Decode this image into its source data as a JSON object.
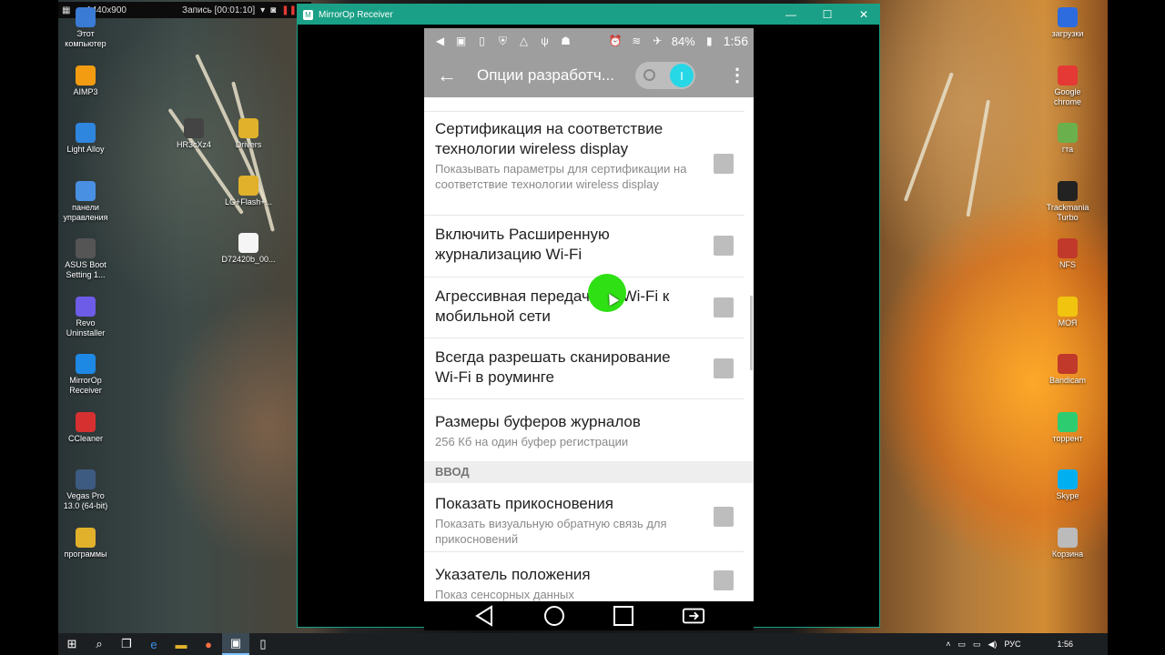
{
  "recorder": {
    "resolution": "1440x900",
    "recording_label": "Запись [00:01:10]"
  },
  "desktop_left_icons": [
    {
      "label": "Этот компьютер",
      "icon": "computer-icon",
      "color": "#3a7bd5"
    },
    {
      "label": "AIMP3",
      "icon": "aimp-icon",
      "color": "#f39c12"
    },
    {
      "label": "Light Alloy",
      "icon": "light-alloy-icon",
      "color": "#2e86de"
    },
    {
      "label": "панели управления",
      "icon": "control-panel-icon",
      "color": "#4a90e2"
    },
    {
      "label": "ASUS Boot Setting 1...",
      "icon": "asus-icon",
      "color": "#555"
    },
    {
      "label": "Revo Uninstaller",
      "icon": "revo-icon",
      "color": "#6c5ce7"
    },
    {
      "label": "MirrorOp Receiver",
      "icon": "mirrorop-icon",
      "color": "#1e88e5"
    },
    {
      "label": "CCleaner",
      "icon": "ccleaner-icon",
      "color": "#d63031"
    },
    {
      "label": "Vegas Pro 13.0 (64-bit)",
      "icon": "vegas-icon",
      "color": "#3d5a80"
    },
    {
      "label": "программы",
      "icon": "folder-icon",
      "color": "#e1b12c"
    }
  ],
  "desktop_mid_icons": [
    {
      "label": "HR3cXz4",
      "icon": "file-icon",
      "color": "#444"
    },
    {
      "label": "Drivers",
      "icon": "folder-icon",
      "color": "#e1b12c"
    },
    {
      "label": "LG+Flash+...",
      "icon": "folder-icon",
      "color": "#e1b12c"
    },
    {
      "label": "D72420b_00...",
      "icon": "document-icon",
      "color": "#f5f5f5"
    }
  ],
  "desktop_right_icons": [
    {
      "label": "загрузки",
      "icon": "downloads-icon",
      "color": "#2d6cdf"
    },
    {
      "label": "Google chrome",
      "icon": "chrome-icon",
      "color": "#e53935"
    },
    {
      "label": "гта",
      "icon": "gta-icon",
      "color": "#6ab04c"
    },
    {
      "label": "Trackmania Turbo",
      "icon": "trackmania-icon",
      "color": "#222"
    },
    {
      "label": "NFS",
      "icon": "nfs-icon",
      "color": "#c0392b"
    },
    {
      "label": "МОЯ",
      "icon": "warning-icon",
      "color": "#f1c40f"
    },
    {
      "label": "Bandicam",
      "icon": "bandicam-icon",
      "color": "#c0392b"
    },
    {
      "label": "торрент",
      "icon": "utorrent-icon",
      "color": "#2ecc71"
    },
    {
      "label": "Skype",
      "icon": "skype-icon",
      "color": "#00aff0"
    },
    {
      "label": "Корзина",
      "icon": "recycle-bin-icon",
      "color": "#bbb"
    }
  ],
  "window": {
    "title": "MirrorOp Receiver",
    "min": "—",
    "max": "☐",
    "close": "✕"
  },
  "phone": {
    "battery": "84%",
    "time": "1:56",
    "appbar_title": "Опции разработч...",
    "items": [
      {
        "title": "Сертификация на соответствие технологии wireless display",
        "subtitle": "Показывать параметры для сертификации на соответствие технологии wireless display"
      },
      {
        "title": "Включить Расширенную журнализацию Wi-Fi",
        "subtitle": ""
      },
      {
        "title": "Агрессивная передача от Wi-Fi к мобильной сети",
        "subtitle": ""
      },
      {
        "title": "Всегда разрешать сканирование Wi-Fi в роуминге",
        "subtitle": ""
      },
      {
        "title": "Размеры буферов журналов",
        "subtitle": "256 Кб на один буфер регистрации"
      },
      {
        "title": "Показать прикосновения",
        "subtitle": "Показать визуальную обратную связь для прикосновений"
      },
      {
        "title": "Указатель положения",
        "subtitle": "Показ сенсорных данных"
      }
    ],
    "section_input": "ВВОД"
  },
  "taskbar": {
    "lang": "РУС",
    "clock": "1:56"
  }
}
